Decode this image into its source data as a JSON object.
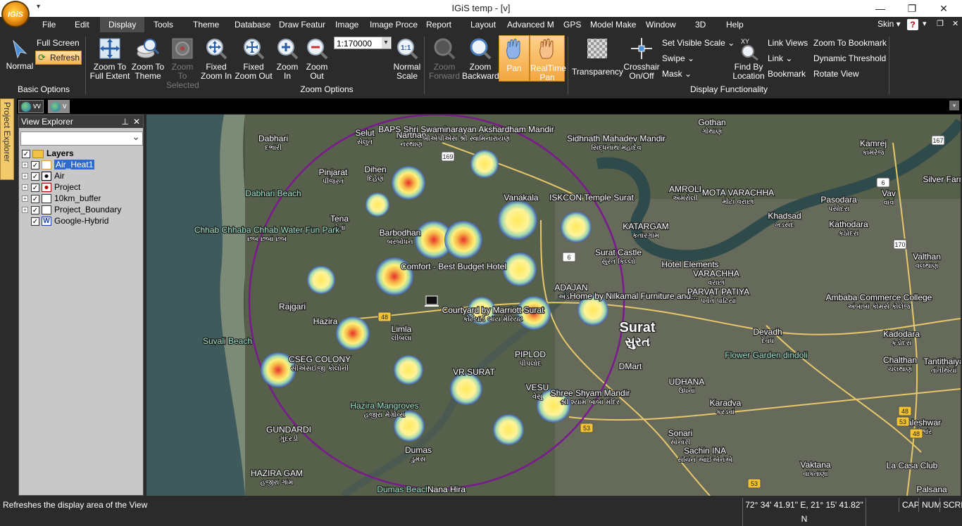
{
  "app": {
    "title": "IGiS temp - [v]",
    "logo_text": "IGiS"
  },
  "menu": [
    "File",
    "Edit",
    "Display",
    "Tools",
    "Theme",
    "Database",
    "Draw Featur",
    "Image",
    "Image Proce",
    "Report",
    "Layout",
    "Advanced M",
    "GPS",
    "Model Make",
    "Window",
    "3D",
    "Help"
  ],
  "menu_active": "Display",
  "skin": "Skin",
  "ribbon": {
    "basic": {
      "normal": "Normal",
      "full_screen": "Full Screen",
      "refresh": "Refresh",
      "group": "Basic Options"
    },
    "zoom": {
      "full_extent": "Zoom To Full Extent",
      "to_theme": "Zoom To Theme",
      "to_selected": "Zoom To Selected",
      "fixed_in": "Fixed Zoom In",
      "fixed_out": "Fixed Zoom Out",
      "zoom_in": "Zoom In",
      "zoom_out": "Zoom Out",
      "scale_value": "1:170000",
      "normal_scale": "Normal Scale",
      "forward": "Zoom Forward",
      "backward": "Zoom Backward",
      "pan": "Pan",
      "realtime_pan": "RealTime Pan",
      "group": "Zoom Options"
    },
    "display": {
      "transparency": "Transparency",
      "crosshair": "Crosshair On/Off",
      "visible_scale": "Set Visible Scale",
      "swipe": "Swipe",
      "mask": "Mask",
      "find_loc": "Find By Location",
      "link_views": "Link Views",
      "link": "Link",
      "bookmark": "Bookmark",
      "zoom_bookmark": "Zoom To Bookmark",
      "dyn_threshold": "Dynamic Threshold",
      "rotate": "Rotate View",
      "group": "Display Functionality"
    }
  },
  "tabs": [
    "vv",
    "v"
  ],
  "project_explorer": "Project Explorer",
  "view_explorer": {
    "title": "View Explorer",
    "root": "Layers",
    "layers": [
      {
        "name": "Air_Heat1",
        "checked": true,
        "selected": true,
        "expand": true
      },
      {
        "name": "Air",
        "checked": true,
        "expand": true
      },
      {
        "name": "Project",
        "checked": true,
        "expand": true
      },
      {
        "name": "10km_buffer",
        "checked": true,
        "expand": true
      },
      {
        "name": "Project_Boundary",
        "checked": true,
        "expand": true
      },
      {
        "name": "Google-Hybrid",
        "checked": true,
        "expand": false
      }
    ]
  },
  "map_labels": [
    {
      "t": "Dabhari",
      "s": "દભારી"
    },
    {
      "t": "Selut",
      "s": "સેલુત"
    },
    {
      "t": "Narthan",
      "s": "નરથાણ"
    },
    {
      "t": "BAPS Shri Swaminarayan Akshardham Mandir",
      "s": "બીએપીએસ શ્રી સ્વામિનારાયણ"
    },
    {
      "t": "Sidhnath Mahadev Mandir",
      "s": "સિદ્ધનાથ મહાદેવ"
    },
    {
      "t": "Gothan",
      "s": "ગોથાણ"
    },
    {
      "t": "Kamrej",
      "s": "કામરેજ"
    },
    {
      "t": "Pinjarat",
      "s": "પીંજરત"
    },
    {
      "t": "Dihen",
      "s": "દિહેણ"
    },
    {
      "t": "Vanakala",
      "s": ""
    },
    {
      "t": "ISKCON Temple Surat",
      "s": ""
    },
    {
      "t": "AMROLI",
      "s": "અમરોલી"
    },
    {
      "t": "MOTA VARACHHA",
      "s": "મોટા વરાછા"
    },
    {
      "t": "Pasodara",
      "s": "પસોદરા"
    },
    {
      "t": "Vav",
      "s": "વાવ"
    },
    {
      "t": "Silver Farm",
      "s": ""
    },
    {
      "t": "Dabhari Beach",
      "s": ""
    },
    {
      "t": "Tena",
      "s": "તેના"
    },
    {
      "t": "Barbodhan",
      "s": "બરબોધન"
    },
    {
      "t": "Khadsad",
      "s": "ખડસદ"
    },
    {
      "t": "Kathodara",
      "s": "કઠોદરા"
    },
    {
      "t": "Chhab Chhaba Chhab Water Fun Park",
      "s": "છબ છબા છબ"
    },
    {
      "t": "KATARGAM",
      "s": "કતારગામ"
    },
    {
      "t": "Surat Castle",
      "s": "સુરત કિલ્લો"
    },
    {
      "t": "Hotel Elements",
      "s": ""
    },
    {
      "t": "Valthan",
      "s": "વલથાણ"
    },
    {
      "t": "Comfort - Best Budget Hotel",
      "s": ""
    },
    {
      "t": "ADAJAN",
      "s": "અડાજણ"
    },
    {
      "t": "VARACHHA",
      "s": "વરાછા"
    },
    {
      "t": "Home by Nilkamal Furniture and...",
      "s": ""
    },
    {
      "t": "PARVAT PATIYA",
      "s": "પર્વત પાટિયા"
    },
    {
      "t": "Ambaba Commerce College",
      "s": "અંબાબા કોમર્સ કોલેજ"
    },
    {
      "t": "Rajgari",
      "s": ""
    },
    {
      "t": "Courtyard by Marriott Surat",
      "s": "કોર્ટયાર્ડ બાય મેરિયટ"
    },
    {
      "t": "Surat",
      "s": "સુરત"
    },
    {
      "t": "Hazira",
      "s": ""
    },
    {
      "t": "Limla",
      "s": "લીંબલા"
    },
    {
      "t": "Devadh",
      "s": "દેવધ"
    },
    {
      "t": "Kadodara",
      "s": "કડોદરા"
    },
    {
      "t": "Suvali Beach",
      "s": ""
    },
    {
      "t": "PIPLOD",
      "s": "પીપલોદ"
    },
    {
      "t": "Flower Garden dindoli",
      "s": ""
    },
    {
      "t": "Chalthan",
      "s": "ચલથાણ"
    },
    {
      "t": "Tantithaiya",
      "s": "તાંતીથૈયા"
    },
    {
      "t": "CSEG COLONY",
      "s": "સીએસઈજી કોલોની"
    },
    {
      "t": "VR SURAT",
      "s": ""
    },
    {
      "t": "DMart",
      "s": ""
    },
    {
      "t": "UDHANA",
      "s": "ઉધના"
    },
    {
      "t": "Shree Shyam Mandir",
      "s": "શ્રી શ્યામ બાબા મંદિર"
    },
    {
      "t": "VESU",
      "s": "વેસુ"
    },
    {
      "t": "Karadva",
      "s": "કરડવા"
    },
    {
      "t": "Hazira Mangroves",
      "s": "હજીરા મેંગ્રોવ્સ"
    },
    {
      "t": "Baleshwar",
      "s": "બલેશ્વર"
    },
    {
      "t": "GUNDARDI",
      "s": "ગુંદરડી"
    },
    {
      "t": "Dumas",
      "s": "ડુમસ"
    },
    {
      "t": "Sonari",
      "s": "સોનારી"
    },
    {
      "t": "HAZIRA GAM",
      "s": "હજીરા ગામ"
    },
    {
      "t": "Sachin INA",
      "s": "સચિન આઈએનએ"
    },
    {
      "t": "Vaktana",
      "s": "વાક્તાણા"
    },
    {
      "t": "La Casa Club",
      "s": ""
    },
    {
      "t": "Dumas Beach",
      "s": ""
    },
    {
      "t": "Nana Hira",
      "s": ""
    },
    {
      "t": "Palsana",
      "s": ""
    }
  ],
  "road_numbers": [
    "169",
    "167",
    "6",
    "6",
    "48",
    "48",
    "53",
    "170",
    "53",
    "48",
    "48",
    "53"
  ],
  "status": {
    "message": "Refreshes the display area of the View",
    "coords": "72° 34' 41.91\" E, 21° 15' 41.82\" N",
    "caps": "CAP",
    "num": "NUM",
    "scrl": "SCRL"
  },
  "colors": {
    "heat_core": "#e8302a",
    "heat_mid": "#ffe866",
    "heat_edge": "#3f5fb8",
    "buffer": "#7a1a8e"
  }
}
